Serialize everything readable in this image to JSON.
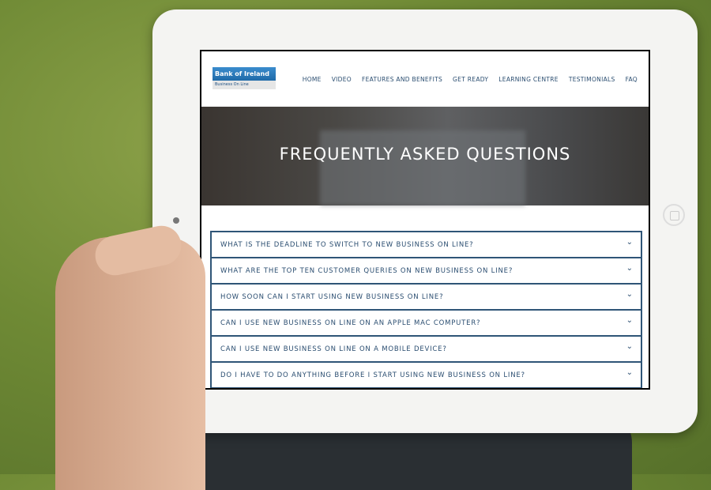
{
  "logo": {
    "brand": "Bank of Ireland",
    "sub": "Business On Line"
  },
  "nav": [
    "HOME",
    "VIDEO",
    "FEATURES AND BENEFITS",
    "GET READY",
    "LEARNING CENTRE",
    "TESTIMONIALS",
    "FAQ"
  ],
  "hero": {
    "title": "FREQUENTLY ASKED QUESTIONS"
  },
  "faq": [
    "WHAT IS THE DEADLINE TO SWITCH TO NEW BUSINESS ON LINE?",
    "WHAT ARE THE TOP TEN CUSTOMER QUERIES ON NEW BUSINESS ON LINE?",
    "HOW SOON CAN I START USING NEW BUSINESS ON LINE?",
    "CAN I USE NEW BUSINESS ON LINE ON AN APPLE MAC COMPUTER?",
    "CAN I USE NEW BUSINESS ON LINE ON A MOBILE DEVICE?",
    "DO I HAVE TO DO ANYTHING BEFORE I START USING NEW BUSINESS ON LINE?"
  ]
}
